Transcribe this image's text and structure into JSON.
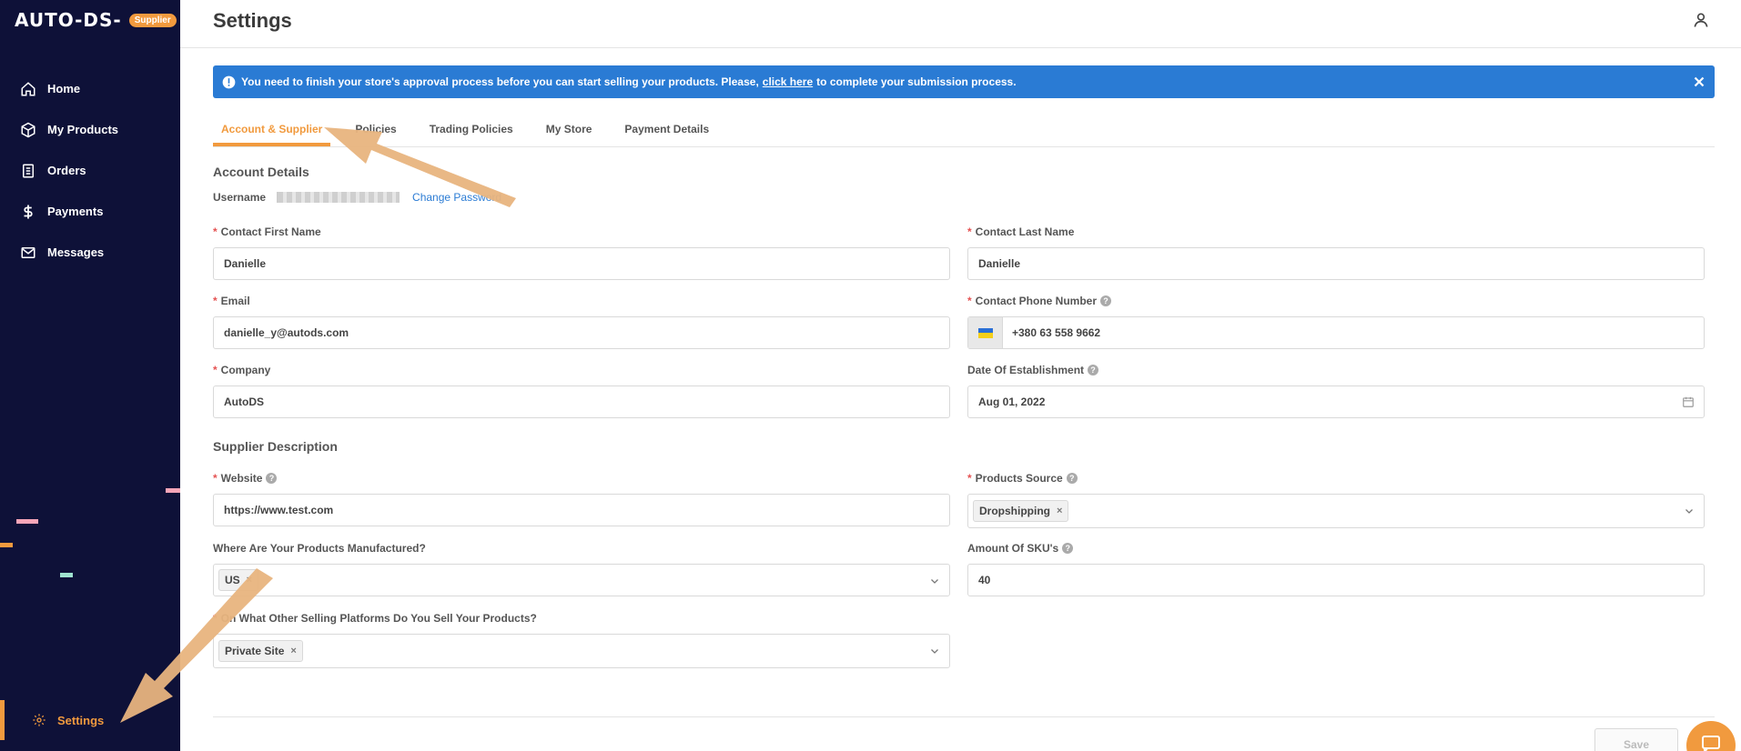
{
  "brand": {
    "logo_text": "AUTO-DS-",
    "badge": "Supplier"
  },
  "sidebar": {
    "items": [
      {
        "label": "Home",
        "icon": "home-icon"
      },
      {
        "label": "My Products",
        "icon": "box-icon"
      },
      {
        "label": "Orders",
        "icon": "clipboard-icon"
      },
      {
        "label": "Payments",
        "icon": "dollar-icon"
      },
      {
        "label": "Messages",
        "icon": "mail-icon"
      }
    ],
    "settings_label": "Settings"
  },
  "header": {
    "title": "Settings"
  },
  "alert": {
    "text_before": "You need to finish your store's approval process before you can start selling your products. Please,",
    "link": "click here",
    "text_after": "to complete your submission process."
  },
  "tabs": [
    "Account & Supplier",
    "Policies",
    "Trading Policies",
    "My Store",
    "Payment Details"
  ],
  "account": {
    "section_title": "Account Details",
    "username_label": "Username",
    "change_password": "Change Password",
    "first_name_label": "Contact First Name",
    "first_name": "Danielle",
    "last_name_label": "Contact Last Name",
    "last_name": "Danielle",
    "email_label": "Email",
    "email": "danielle_y@autods.com",
    "phone_label": "Contact Phone Number",
    "phone": "+380 63 558 9662",
    "company_label": "Company",
    "company": "AutoDS",
    "established_label": "Date Of Establishment",
    "established": "Aug 01, 2022"
  },
  "supplier": {
    "section_title": "Supplier Description",
    "website_label": "Website",
    "website": "https://www.test.com",
    "products_source_label": "Products Source",
    "products_source_tag": "Dropshipping",
    "manufactured_label": "Where Are Your Products Manufactured?",
    "manufactured_tag": "US",
    "sku_label": "Amount Of SKU's",
    "sku": "40",
    "platforms_label": "On What Other Selling Platforms Do You Sell Your Products?",
    "platforms_tag": "Private Site"
  },
  "footer": {
    "save": "Save"
  },
  "colors": {
    "sidebar_bg": "#0e1138",
    "accent": "#f19a3e",
    "alert_bg": "#2a7bd4",
    "required": "#e55353"
  }
}
